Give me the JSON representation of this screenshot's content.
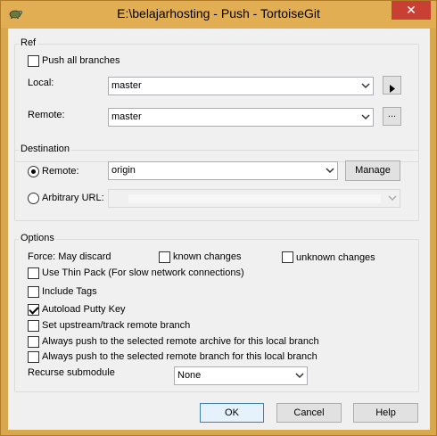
{
  "window": {
    "title": "E:\\belajarhosting - Push - TortoiseGit",
    "close_glyph": "✕"
  },
  "ref": {
    "group_label": "Ref",
    "push_all_label": "Push all branches",
    "push_all_checked": false,
    "local_label": "Local:",
    "local_value": "master",
    "remote_label": "Remote:",
    "remote_value": "master",
    "more_button": "..."
  },
  "destination": {
    "group_label": "Destination",
    "remote_radio_label": "Remote:",
    "remote_radio_checked": true,
    "remote_value": "origin",
    "manage_button": "Manage",
    "url_radio_label": "Arbitrary URL:",
    "url_radio_checked": false,
    "url_value": ""
  },
  "options": {
    "group_label": "Options",
    "force_label": "Force: May discard",
    "known_changes_label": "known changes",
    "known_changes_checked": false,
    "unknown_changes_label": "unknown changes",
    "unknown_changes_checked": false,
    "thin_pack_label": "Use Thin Pack (For slow network connections)",
    "thin_pack_checked": false,
    "include_tags_label": "Include Tags",
    "include_tags_checked": false,
    "autoload_putty_label": "Autoload Putty Key",
    "autoload_putty_checked": true,
    "set_upstream_label": "Set upstream/track remote branch",
    "set_upstream_checked": false,
    "always_archive_label": "Always push to the selected remote archive for this local branch",
    "always_archive_checked": false,
    "always_branch_label": "Always push to the selected remote branch for this local branch",
    "always_branch_checked": false,
    "recurse_label": "Recurse submodule",
    "recurse_value": "None"
  },
  "buttons": {
    "ok": "OK",
    "cancel": "Cancel",
    "help": "Help"
  },
  "colors": {
    "titlebar": "#e1ae54",
    "close": "#c84034",
    "dialog_bg": "#f0f0f0",
    "default_button_border": "#3c7fb1"
  },
  "icons": {
    "app": "tortoise-icon",
    "arrow_right": "play-arrow-icon",
    "dropdown": "chevron-down-icon"
  }
}
